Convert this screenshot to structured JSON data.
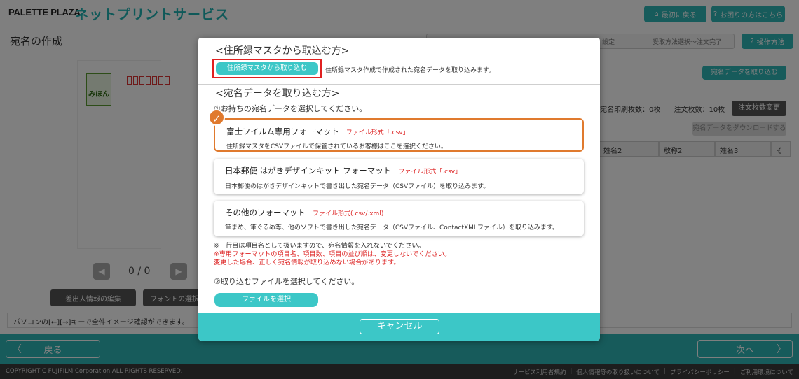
{
  "app": {
    "brand": "PALETTE PLAZA",
    "service": "ネットプリントサービス",
    "home_btn": "最初に戻る",
    "help_btn": "お困りの方はこちら",
    "page_title": "宛名の作成",
    "steps": [
      "設定",
      "受取方法選択～注文完了"
    ],
    "op_btn": "操作方法",
    "pager_text": "0 / 0",
    "edit_sender_btn": "差出人情報の編集",
    "font_btn": "フォントの選択",
    "note": "パソコンの[←][→]キーで全件イメージ確認ができます。",
    "import_btn": "宛名データを取り込む",
    "print_count": "宛名印刷枚数：0枚",
    "order_count": "注文枚数：10枚",
    "order_change_btn": "注文枚数変更",
    "download_btn": "宛名データをダウンロードする",
    "columns": [
      "姓名2",
      "敬称2",
      "姓名3",
      "そ"
    ],
    "mihon": "みほん",
    "back_btn": "戻る",
    "next_btn": "次へ",
    "copyright": "COPYRIGHT C FUJIFILM Corporation ALL RIGHTS RESERVED.",
    "footer_links": [
      "サービス利用者規約",
      "個人情報等の取り扱いについて",
      "プライバシーポリシー",
      "ご利用環境について"
    ]
  },
  "modal": {
    "section1_title": "<住所録マスタから取込む方>",
    "master_btn": "住所録マスタから取り込む",
    "master_desc": "住所録マスタ作成で作成された宛名データを取り込みます。",
    "section2_title": "<宛名データを取り込む方>",
    "step1": "①お持ちの宛名データを選択してください。",
    "options": [
      {
        "name": "富士フイルム専用フォーマット",
        "format": "ファイル形式「.csv」",
        "desc": "住所録マスタをCSVファイルで保管されているお客様はここを選択ください。",
        "selected": true
      },
      {
        "name": "日本郵便 はがきデザインキット フォーマット",
        "format": "ファイル形式「.csv」",
        "desc": "日本郵便のはがきデザインキットで書き出した宛名データ（CSVファイル）を取り込みます。",
        "selected": false
      },
      {
        "name": "その他のフォーマット",
        "format": "ファイル形式(.csv/.xml)",
        "desc": "筆まめ、筆ぐるめ等、他のソフトで書き出した宛名データ（CSVファイル、ContactXMLファイル）を取り込みます。",
        "selected": false
      }
    ],
    "note1": "※一行目は項目名として扱いますので、宛名情報を入れないでください。",
    "note2": "※専用フォーマットの項目名、項目数、項目の並び順は、変更しないでください。",
    "note3": "変更した場合、正しく宛名情報が取り込めない場合があります。",
    "step2": "②取り込むファイルを選択してください。",
    "file_btn": "ファイルを選択",
    "cancel_btn": "キャンセル"
  },
  "colors": {
    "teal": "#3cc7c7",
    "selected_border": "#e07a2e",
    "highlight_red": "#e02020"
  }
}
